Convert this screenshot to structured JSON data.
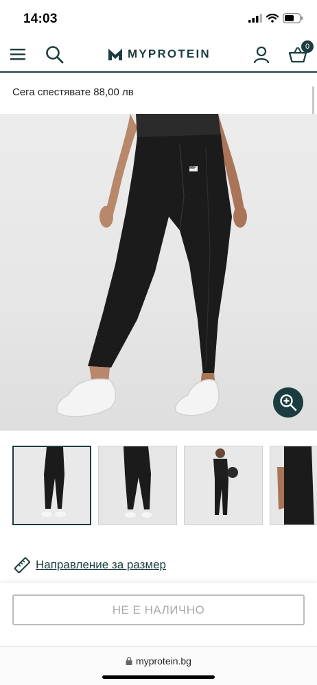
{
  "status_bar": {
    "time": "14:03"
  },
  "header": {
    "brand": "MYPROTEIN",
    "basket_count": "0"
  },
  "product": {
    "savings_text": "Сега спестявате 88,00 лв",
    "hero_logo": "MP",
    "thumbnail_count": 4
  },
  "size_guide": {
    "label": "Направление за размер"
  },
  "cta": {
    "label": "НЕ Е НАЛИЧНО"
  },
  "browser": {
    "url": "myprotein.bg"
  },
  "colors": {
    "brand": "#1b3d3f",
    "disabled": "#a9a9a9"
  },
  "icons": [
    "menu-icon",
    "search-icon",
    "account-icon",
    "basket-icon",
    "zoom-icon",
    "ruler-icon",
    "lock-icon"
  ]
}
